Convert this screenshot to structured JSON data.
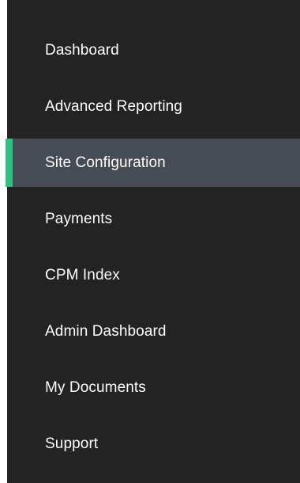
{
  "sidebar": {
    "accent_color": "#2ec27e",
    "active_index": 2,
    "items": [
      {
        "label": "Dashboard"
      },
      {
        "label": "Advanced Reporting"
      },
      {
        "label": "Site Configuration"
      },
      {
        "label": "Payments"
      },
      {
        "label": "CPM Index"
      },
      {
        "label": "Admin Dashboard"
      },
      {
        "label": "My Documents"
      },
      {
        "label": "Support"
      }
    ]
  }
}
